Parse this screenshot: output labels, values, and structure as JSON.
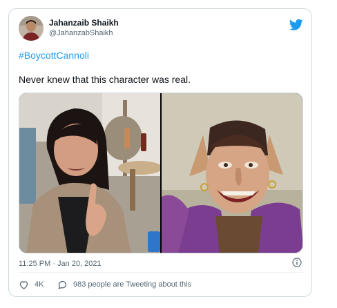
{
  "tweet": {
    "author": {
      "display_name": "Jahanzaib Shaikh",
      "handle": "@JahanzabShaikh"
    },
    "hashtag": "#BoycottCannoli",
    "text": "Never knew that this character was real.",
    "timestamp": "11:25 PM · Jan 20, 2021",
    "actions": {
      "likes": "4K",
      "reply_text": "983 people are Tweeting about this"
    }
  },
  "icons": {
    "brand": "twitter-bird-icon",
    "info": "info-icon",
    "like": "heart-icon",
    "reply": "speech-bubble-icon"
  },
  "colors": {
    "accent": "#1d9bf0",
    "text_primary": "#0f1419",
    "text_secondary": "#536471",
    "border": "#cfd9de"
  }
}
